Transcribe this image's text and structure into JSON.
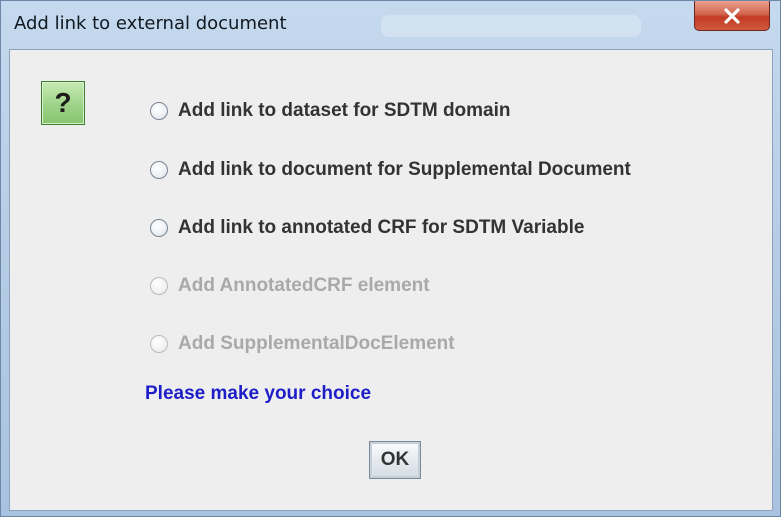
{
  "window": {
    "title": "Add link to external document",
    "close_icon": "close-x-icon"
  },
  "dialog": {
    "icon": "question-mark-icon",
    "icon_text": "?",
    "options": [
      {
        "label": "Add link to dataset for SDTM domain",
        "enabled": true,
        "selected": false
      },
      {
        "label": "Add link to document for Supplemental Document",
        "enabled": true,
        "selected": false
      },
      {
        "label": "Add link to annotated CRF for SDTM Variable",
        "enabled": true,
        "selected": false
      },
      {
        "label": "Add AnnotatedCRF element",
        "enabled": false,
        "selected": false
      },
      {
        "label": "Add SupplementalDocElement",
        "enabled": false,
        "selected": false
      }
    ],
    "prompt": "Please make your choice",
    "ok_label": "OK"
  },
  "colors": {
    "prompt_text": "#1e1ec8",
    "disabled_text": "#a9a9a9",
    "help_icon_bg": "#9ed389",
    "close_button": "#c33b23"
  }
}
